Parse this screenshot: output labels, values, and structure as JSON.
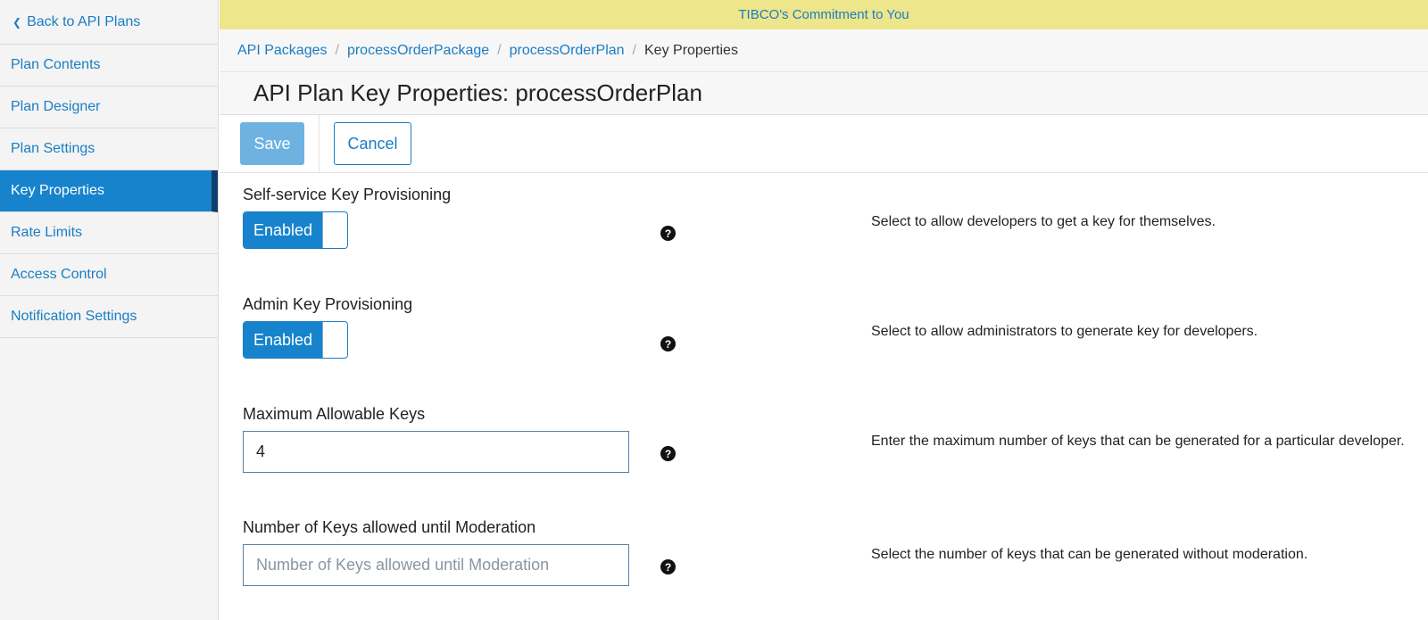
{
  "sidebar": {
    "back_label": "Back to API Plans",
    "items": [
      {
        "label": "Plan Contents"
      },
      {
        "label": "Plan Designer"
      },
      {
        "label": "Plan Settings"
      },
      {
        "label": "Key Properties"
      },
      {
        "label": "Rate Limits"
      },
      {
        "label": "Access Control"
      },
      {
        "label": "Notification Settings"
      }
    ],
    "active_index": 3
  },
  "banner": {
    "text": "TIBCO's Commitment to You"
  },
  "breadcrumb": [
    "API Packages",
    "processOrderPackage",
    "processOrderPlan",
    "Key Properties"
  ],
  "page": {
    "title": "API Plan Key Properties: processOrderPlan"
  },
  "toolbar": {
    "save_label": "Save",
    "cancel_label": "Cancel"
  },
  "fields": {
    "self_service": {
      "label": "Self-service Key Provisioning",
      "toggle_label": "Enabled",
      "help": "?",
      "description": "Select to allow developers to get a key for themselves."
    },
    "admin": {
      "label": "Admin Key Provisioning",
      "toggle_label": "Enabled",
      "help": "?",
      "description": "Select to allow administrators to generate key for developers."
    },
    "max_keys": {
      "label": "Maximum Allowable Keys",
      "value": "4",
      "help": "?",
      "description": "Enter the maximum number of keys that can be generated for a particular developer."
    },
    "moderation": {
      "label": "Number of Keys allowed until Moderation",
      "value": "",
      "placeholder": "Number of Keys allowed until Moderation",
      "help": "?",
      "description": "Select the number of keys that can be generated without moderation."
    }
  },
  "colors": {
    "accent": "#1783cc",
    "banner": "#ede68a",
    "save_disabled": "#6eb2e2"
  }
}
